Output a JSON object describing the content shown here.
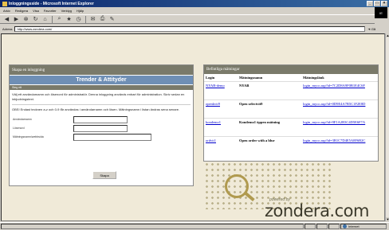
{
  "window": {
    "title": "Inloggningsside - Microsoft Internet Explorer",
    "controls": [
      "_",
      "□",
      "×"
    ]
  },
  "menu": [
    "Arkiv",
    "Redigera",
    "Visa",
    "Favoriter",
    "Verktyg",
    "Hjälp"
  ],
  "brand_badge": "IE",
  "toolbar": {
    "icons": [
      "back-icon",
      "forward-icon",
      "stop-icon",
      "refresh-icon",
      "home-icon",
      "search-icon",
      "favorites-icon",
      "history-icon",
      "mail-icon",
      "print-icon",
      "edit-icon"
    ]
  },
  "address": {
    "label": "Adress",
    "url": "http://www.zondera.com/",
    "go_label": "Gå"
  },
  "login_panel": {
    "header": "Skapa en inloggning",
    "title": "Trender & Attityder",
    "sub_header": "Steg ett",
    "description": "Välj ett användarnamn och lösenord för administratör. Denna inloggning används enbart för administration. Skriv sedan en inbjudningstext.",
    "note": "OBS! Endast tecknen a-z och 0-9 får användas i användarnamn och lösen. Mätningsnamn i listan ändras sena senare.",
    "fields": [
      {
        "label": "Användarnamn",
        "value": ""
      },
      {
        "label": "Lösenord",
        "value": ""
      },
      {
        "label": "Mätningsnamn/webbsida",
        "value": ""
      }
    ],
    "submit_label": "Skapa"
  },
  "surveys_panel": {
    "header": "Befintliga mätningar",
    "columns": [
      "Login",
      "Mätningsnamn",
      "Mätningslänk"
    ],
    "rows": [
      {
        "login": "NYAB-demo",
        "name": "NYAB",
        "link": "login_myco.asp?id=7C2D8A9F0B1E4C6F"
      },
      {
        "login": "openkvit9",
        "name": "Open selectvit9",
        "link": "login_myco.asp?id=0D9E4A7B5C1F2E8D"
      },
      {
        "login": "kondemo1",
        "name": "Kondemo1 öppen mätning",
        "link": "login_myco.asp?id=9F1A2B3C4D5E6F7A"
      },
      {
        "login": "ordvit1",
        "name": "Open order with a blur",
        "link": "login_myco.asp?id=3B1C7D4E5A8F6B2C"
      }
    ]
  },
  "logo": {
    "small_text": "powered by",
    "brand": "zondera.com"
  },
  "status": {
    "text": "",
    "zone": "Internet"
  }
}
